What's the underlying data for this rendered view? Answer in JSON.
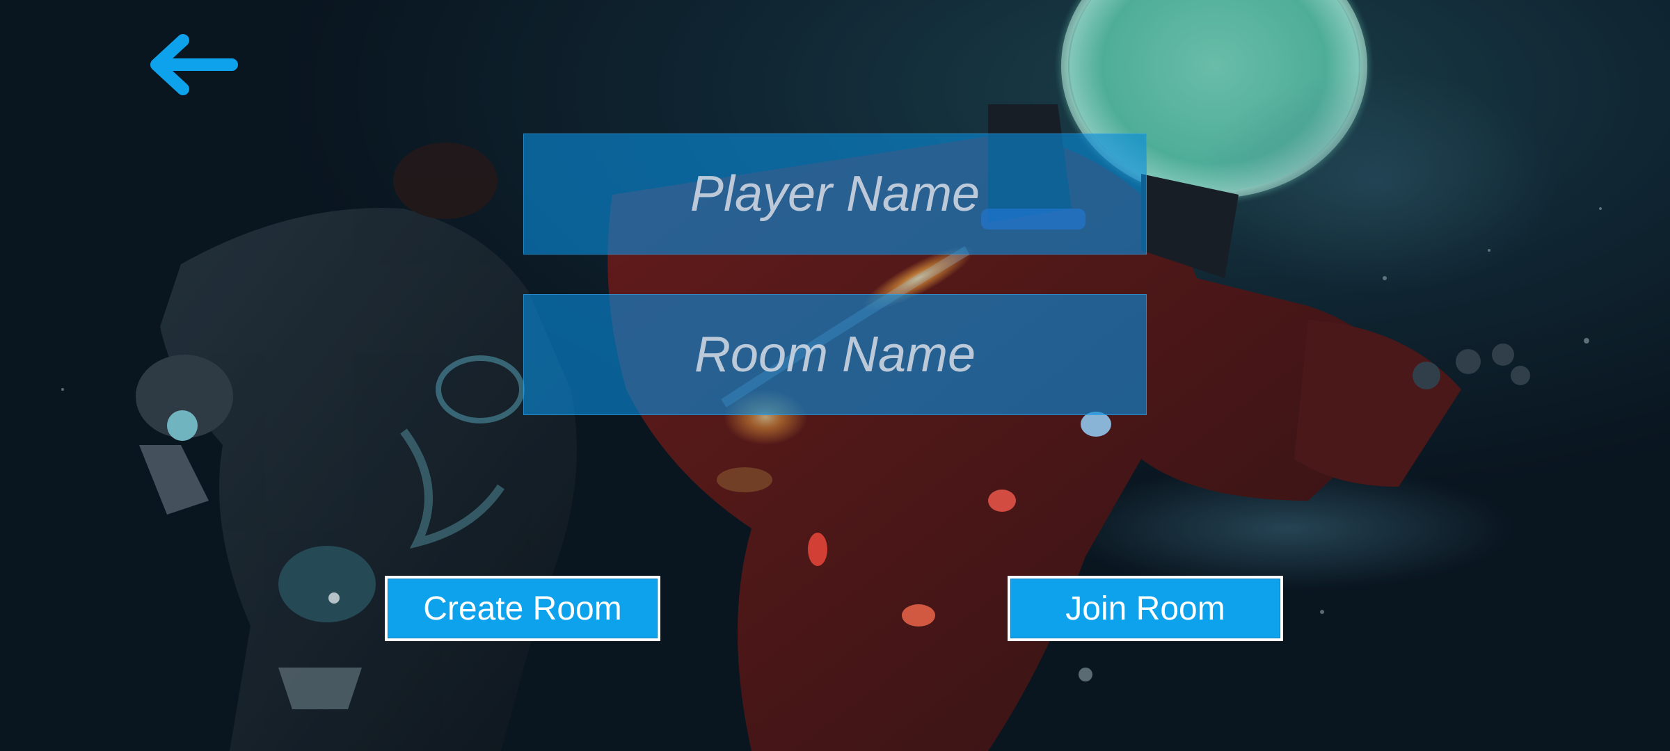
{
  "screen": "room-lobby",
  "icons": {
    "back": "back-arrow-icon"
  },
  "colors": {
    "accent": "#0ea2ec",
    "field_fill": "#0a8cdc",
    "button_border": "#ffffff"
  },
  "form": {
    "player_name": {
      "value": "",
      "placeholder": "Player Name"
    },
    "room_name": {
      "value": "",
      "placeholder": "Room Name"
    }
  },
  "actions": {
    "create_label": "Create Room",
    "join_label": "Join Room"
  }
}
